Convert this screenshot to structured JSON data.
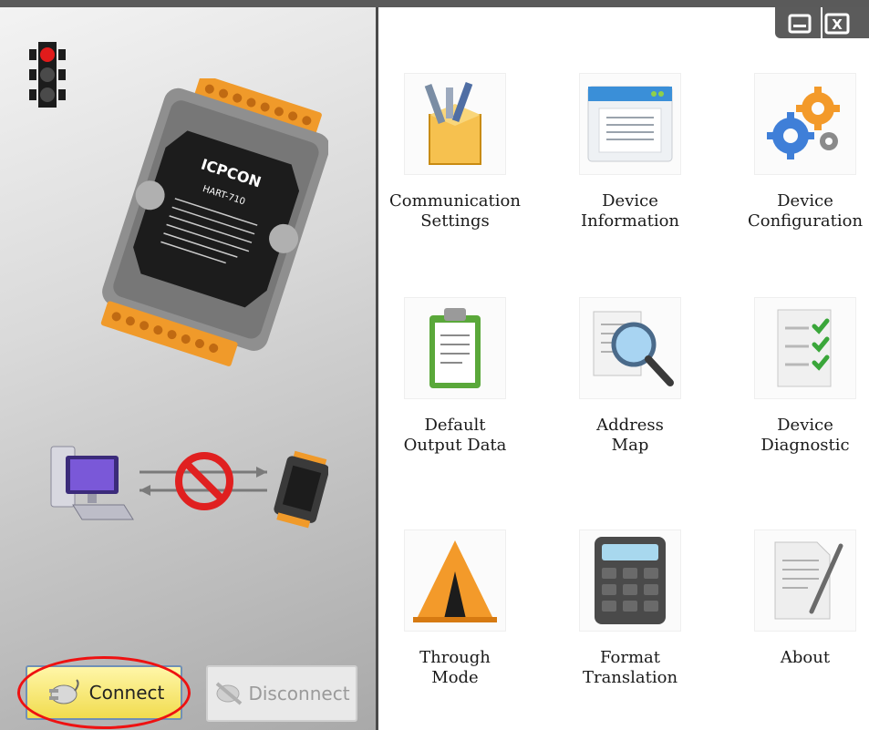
{
  "window_controls": {
    "minimize_label": "",
    "close_label": "X"
  },
  "left": {
    "connect_label": "Connect",
    "disconnect_label": "Disconnect",
    "device_logo_text": "ICPCON",
    "device_model_text": "HART-710"
  },
  "tiles": [
    {
      "label": "Communication\nSettings",
      "icon": "toolbox-icon"
    },
    {
      "label": "Device\nInformation",
      "icon": "info-window-icon"
    },
    {
      "label": "Device\nConfiguration",
      "icon": "gears-icon"
    },
    {
      "label": "Default\nOutput Data",
      "icon": "clipboard-icon"
    },
    {
      "label": "Address\nMap",
      "icon": "magnifier-doc-icon"
    },
    {
      "label": "Device\nDiagnostic",
      "icon": "checklist-icon"
    },
    {
      "label": "Through\nMode",
      "icon": "cone-icon"
    },
    {
      "label": "Format\nTranslation",
      "icon": "calculator-icon"
    },
    {
      "label": "About",
      "icon": "document-pen-icon"
    }
  ],
  "colors": {
    "accent_red": "#e11",
    "button_yellow": "#f1dc4f",
    "tile_orange": "#f39a2a"
  }
}
